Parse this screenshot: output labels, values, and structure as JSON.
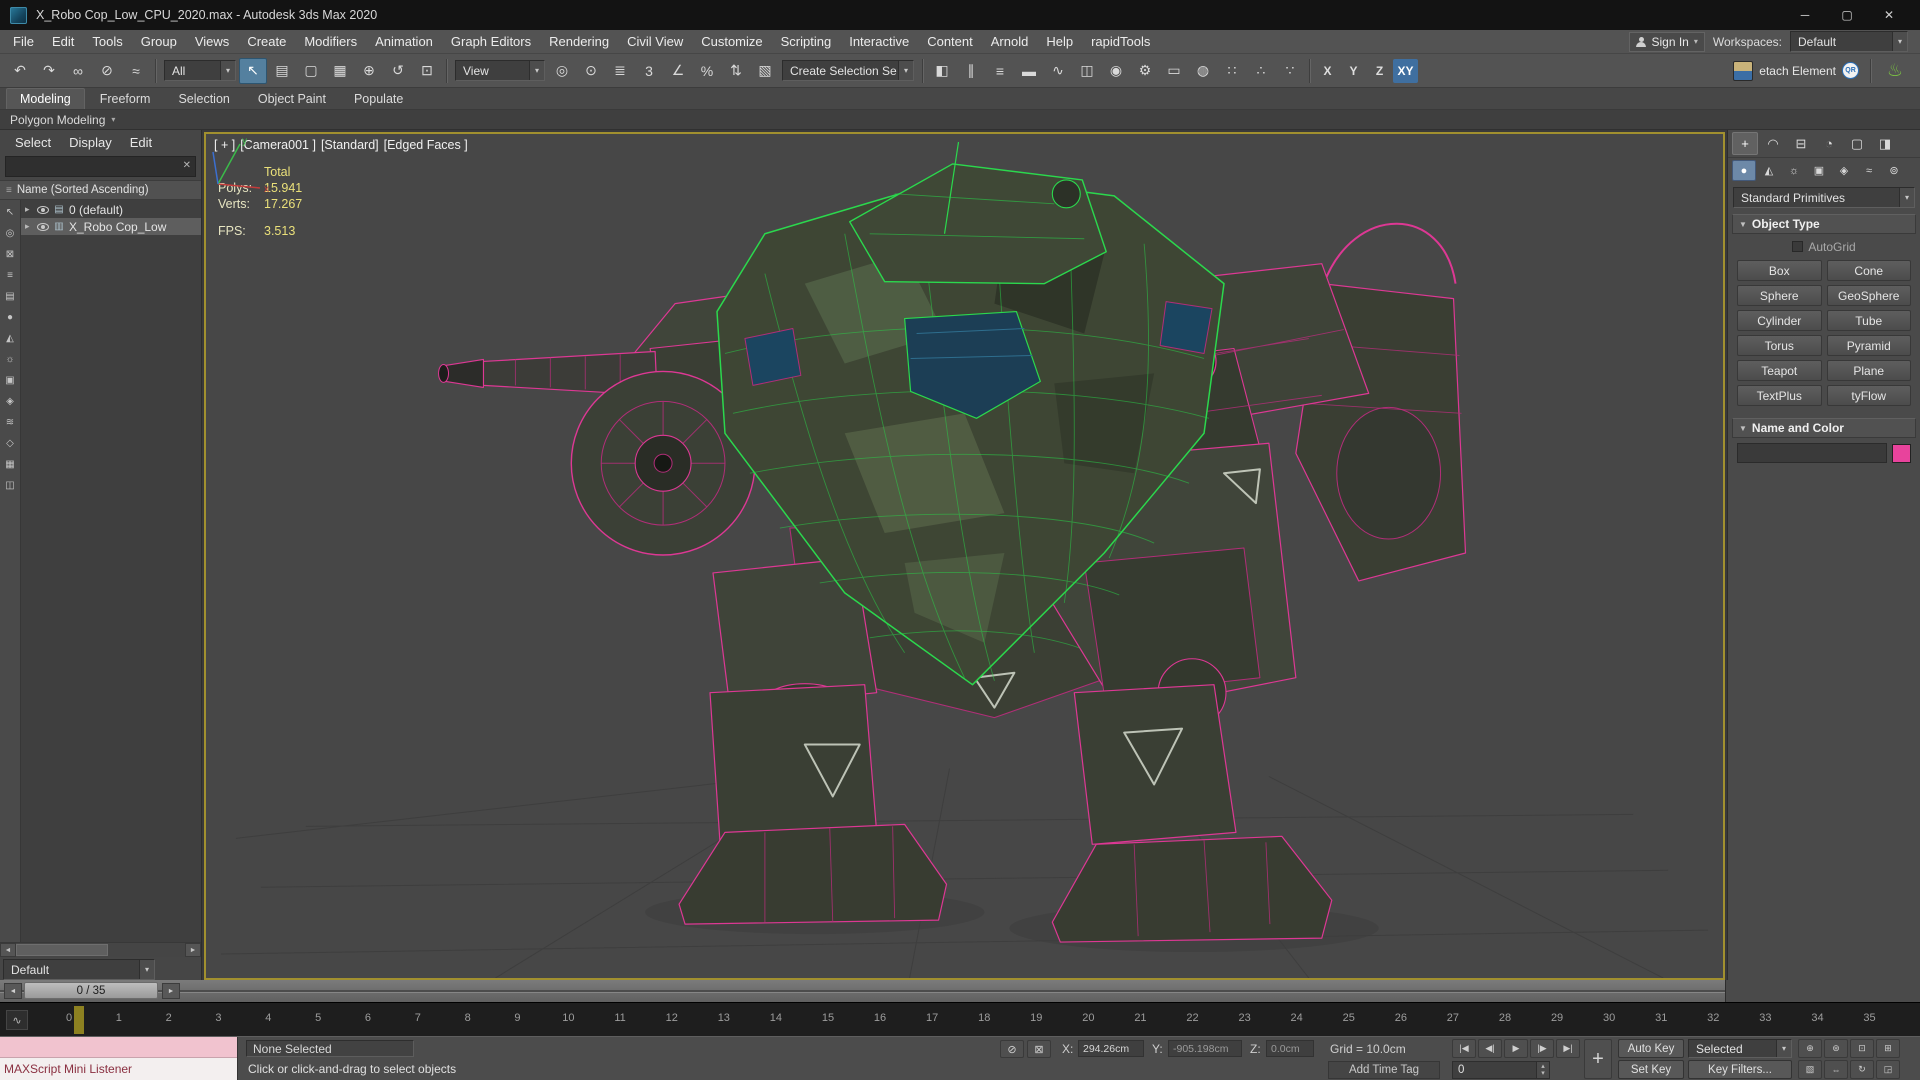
{
  "icons": {
    "caret": "▾",
    "expander": "▸",
    "minimize": "─",
    "maximize": "▢",
    "close": "✕",
    "search_clear": "✕",
    "scroll_left": "◄",
    "scroll_right": "►",
    "nudge_left": "◄",
    "nudge_right": "►",
    "spin_up": "▴",
    "spin_down": "▾",
    "rollout_open": "▼",
    "mini_curve": "∿",
    "sort": "≡",
    "teapot": "♨",
    "qr": "QR",
    "set_keys": "+"
  },
  "window": {
    "title": "X_Robo Cop_Low_CPU_2020.max - Autodesk 3ds Max 2020"
  },
  "menubar": {
    "items": [
      "File",
      "Edit",
      "Tools",
      "Group",
      "Views",
      "Create",
      "Modifiers",
      "Animation",
      "Graph Editors",
      "Rendering",
      "Civil View",
      "Customize",
      "Scripting",
      "Interactive",
      "Content",
      "Arnold",
      "Help",
      "rapidTools"
    ],
    "sign_in": "Sign In",
    "workspaces_label": "Workspaces:",
    "workspace_value": "Default"
  },
  "toolbar": {
    "filter_value": "All",
    "coord_value": "View",
    "named_sets_value": "Create Selection Se",
    "right_label": "etach Element",
    "icons_a": [
      {
        "name": "undo-icon",
        "glyph": "↶"
      },
      {
        "name": "redo-icon",
        "glyph": "↷"
      },
      {
        "name": "select-and-link-icon",
        "glyph": "∞"
      },
      {
        "name": "unlink-selection-icon",
        "glyph": "⊘"
      },
      {
        "name": "bind-to-space-warp-icon",
        "glyph": "≈"
      }
    ],
    "icons_b": [
      {
        "name": "select-object-icon",
        "glyph": "↖",
        "cls": "active"
      },
      {
        "name": "select-by-name-icon",
        "glyph": "▤"
      },
      {
        "name": "rectangular-selection-region-icon",
        "glyph": "▢"
      },
      {
        "name": "window-crossing-icon",
        "glyph": "▦"
      },
      {
        "name": "select-and-move-icon",
        "glyph": "⊕"
      },
      {
        "name": "select-and-rotate-icon",
        "glyph": "↺"
      },
      {
        "name": "select-and-scale-icon",
        "glyph": "⊡"
      }
    ],
    "icons_c": [
      {
        "name": "use-pivot-point-icon",
        "glyph": "◎"
      },
      {
        "name": "select-and-manipulate-icon",
        "glyph": "⊙"
      },
      {
        "name": "keyboard-shortcut-override-icon",
        "glyph": "≣"
      },
      {
        "name": "snap-toggle-3d-icon",
        "glyph": "3"
      },
      {
        "name": "angle-snap-icon",
        "glyph": "∠"
      },
      {
        "name": "percent-snap-icon",
        "glyph": "%"
      },
      {
        "name": "spinner-snap-icon",
        "glyph": "⇅"
      },
      {
        "name": "named-selection-sets-icon",
        "glyph": "▧"
      }
    ],
    "icons_d": [
      {
        "name": "mirror-icon",
        "glyph": "◧"
      },
      {
        "name": "align-icon",
        "glyph": "∥"
      },
      {
        "name": "layer-manager-icon",
        "glyph": "≡"
      },
      {
        "name": "ribbon-toggle-icon",
        "glyph": "▬"
      },
      {
        "name": "curve-editor-icon",
        "glyph": "∿"
      },
      {
        "name": "schematic-view-icon",
        "glyph": "◫"
      },
      {
        "name": "material-editor-icon",
        "glyph": "◉"
      },
      {
        "name": "render-setup-icon",
        "glyph": "⚙"
      },
      {
        "name": "rendered-frame-window-icon",
        "glyph": "▭"
      },
      {
        "name": "render-production-icon",
        "glyph": "◍"
      },
      {
        "name": "snap-array-icon-1",
        "glyph": "∷"
      },
      {
        "name": "snap-array-icon-2",
        "glyph": "∴"
      },
      {
        "name": "snap-array-icon-3",
        "glyph": "∵"
      }
    ],
    "axis_buttons": [
      {
        "label": "X",
        "name": "axis-constraint-x-button"
      },
      {
        "label": "Y",
        "name": "axis-constraint-y-button"
      },
      {
        "label": "Z",
        "name": "axis-constraint-z-button"
      },
      {
        "label": "XY",
        "name": "axis-constraint-xy-button",
        "cls": "active"
      }
    ]
  },
  "ribbon": {
    "tabs": [
      {
        "label": "Modeling",
        "cls": "active"
      },
      {
        "label": "Freeform"
      },
      {
        "label": "Selection"
      },
      {
        "label": "Object Paint"
      },
      {
        "label": "Populate"
      }
    ],
    "panel_label": "Polygon Modeling"
  },
  "scene_explorer": {
    "tabs": [
      "Select",
      "Display",
      "Edit"
    ],
    "column_header": "Name (Sorted Ascending)",
    "rows": [
      {
        "label": "0 (default)",
        "icon": "▤"
      },
      {
        "label": "X_Robo Cop_Low",
        "icon": "▥",
        "cls": "selected"
      }
    ],
    "preset_value": "Default",
    "toolbar_icons": [
      {
        "name": "explorer-pick-icon",
        "glyph": "↖"
      },
      {
        "name": "explorer-find-icon",
        "glyph": "◎"
      },
      {
        "name": "explorer-lock-icon",
        "glyph": "⊠"
      },
      {
        "name": "explorer-hierarchy-icon",
        "glyph": "≡"
      },
      {
        "name": "explorer-layers-icon",
        "glyph": "▤"
      },
      {
        "name": "explorer-geometry-filter-icon",
        "glyph": "●"
      },
      {
        "name": "explorer-shapes-filter-icon",
        "glyph": "◭"
      },
      {
        "name": "explorer-lights-filter-icon",
        "glyph": "☼"
      },
      {
        "name": "explorer-cameras-filter-icon",
        "glyph": "▣"
      },
      {
        "name": "explorer-helpers-filter-icon",
        "glyph": "◈"
      },
      {
        "name": "explorer-spacewarps-filter-icon",
        "glyph": "≋"
      },
      {
        "name": "explorer-bones-filter-icon",
        "glyph": "◇"
      },
      {
        "name": "explorer-containers-filter-icon",
        "glyph": "▦"
      },
      {
        "name": "explorer-xrefs-filter-icon",
        "glyph": "◫"
      }
    ]
  },
  "viewport": {
    "label_segments": [
      "[ + ]",
      "[Camera001 ]",
      "[Standard]",
      "[Edged Faces ]"
    ],
    "stats": {
      "total_label": "Total",
      "polys_label": "Polys:",
      "polys_value": "15.941",
      "verts_label": "Verts:",
      "verts_value": "17.267",
      "fps_label": "FPS:",
      "fps_value": "3.513"
    }
  },
  "command_panel": {
    "tabs": [
      {
        "name": "create-tab-icon",
        "glyph": "+",
        "cls": "active"
      },
      {
        "name": "modify-tab-icon",
        "glyph": "◠"
      },
      {
        "name": "hierarchy-tab-icon",
        "glyph": "⊟"
      },
      {
        "name": "motion-tab-icon",
        "glyph": "◔"
      },
      {
        "name": "display-tab-icon",
        "glyph": "▢"
      },
      {
        "name": "utilities-tab-icon",
        "glyph": "◨"
      }
    ],
    "categories": [
      {
        "name": "geometry-category-icon",
        "glyph": "●",
        "cls": "active"
      },
      {
        "name": "shapes-category-icon",
        "glyph": "◭"
      },
      {
        "name": "lights-category-icon",
        "glyph": "☼"
      },
      {
        "name": "cameras-category-icon",
        "glyph": "▣"
      },
      {
        "name": "helpers-category-icon",
        "glyph": "◈"
      },
      {
        "name": "spacewarps-category-icon",
        "glyph": "≈"
      },
      {
        "name": "systems-category-icon",
        "glyph": "⊚"
      }
    ],
    "dropdown_value": "Standard Primitives",
    "object_type_label": "Object Type",
    "autogrid_label": "AutoGrid",
    "primitive_buttons": [
      "Box",
      "Cone",
      "Sphere",
      "GeoSphere",
      "Cylinder",
      "Tube",
      "Torus",
      "Pyramid",
      "Teapot",
      "Plane",
      "TextPlus",
      "tyFlow"
    ],
    "name_color_label": "Name and Color",
    "object_color": "#e8439c"
  },
  "timeline": {
    "handle_label": "0 / 35",
    "frames": [
      0,
      1,
      2,
      3,
      4,
      5,
      6,
      7,
      8,
      9,
      10,
      11,
      12,
      13,
      14,
      15,
      16,
      17,
      18,
      19,
      20,
      21,
      22,
      23,
      24,
      25,
      26,
      27,
      28,
      29,
      30,
      31,
      32,
      33,
      34,
      35
    ]
  },
  "statusbar": {
    "maxscript_label": "MAXScript Mini Listener",
    "selection_status": "None Selected",
    "prompt": "Click or click-and-drag to select objects",
    "isolate_icon": "⊘",
    "lock_icon": "⊠",
    "x_label": "X:",
    "x_value": "294.26cm",
    "y_label": "Y:",
    "y_value": "-905.198cm",
    "z_label": "Z:",
    "z_value": "0.0cm",
    "grid_label": "Grid = 10.0cm",
    "add_time_tag": "Add Time Tag",
    "time_value": "0",
    "auto_key_label": "Auto Key",
    "set_key_label": "Set Key",
    "selected_value": "Selected",
    "key_filters_label": "Key Filters...",
    "transport": [
      {
        "name": "go-to-start-button",
        "glyph": "|◀"
      },
      {
        "name": "previous-frame-button",
        "glyph": "◀|"
      },
      {
        "name": "play-button",
        "glyph": "▶"
      },
      {
        "name": "next-frame-button",
        "glyph": "|▶"
      },
      {
        "name": "go-to-end-button",
        "glyph": "▶|"
      }
    ],
    "nav_icons_top": [
      {
        "name": "zoom-icon",
        "glyph": "⊕"
      },
      {
        "name": "zoom-all-icon",
        "glyph": "⊛"
      },
      {
        "name": "zoom-extents-icon",
        "glyph": "⊡"
      },
      {
        "name": "zoom-extents-all-icon",
        "glyph": "⊞"
      }
    ],
    "nav_icons_bottom": [
      {
        "name": "zoom-region-icon",
        "glyph": "▧"
      },
      {
        "name": "pan-icon",
        "glyph": "⇔"
      },
      {
        "name": "orbit-icon",
        "glyph": "↻"
      },
      {
        "name": "maximize-viewport-icon",
        "glyph": "◲"
      }
    ]
  }
}
